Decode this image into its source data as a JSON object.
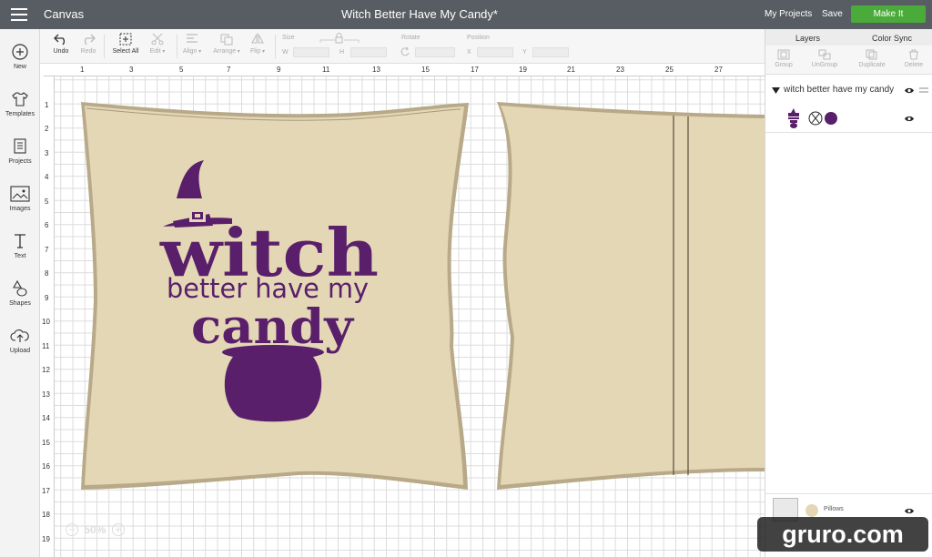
{
  "topbar": {
    "menu_icon": "hamburger-icon",
    "app_name": "Canvas",
    "document_title": "Witch Better Have My Candy*",
    "my_projects": "My Projects",
    "save": "Save",
    "make_it": "Make It",
    "make_it_color": "#4bab3a"
  },
  "sidebar": {
    "items": [
      {
        "label": "New",
        "icon": "plus-circle-icon"
      },
      {
        "label": "Templates",
        "icon": "tshirt-icon"
      },
      {
        "label": "Projects",
        "icon": "projects-icon"
      },
      {
        "label": "Images",
        "icon": "image-icon"
      },
      {
        "label": "Text",
        "icon": "text-icon"
      },
      {
        "label": "Shapes",
        "icon": "shapes-icon"
      },
      {
        "label": "Upload",
        "icon": "upload-cloud-icon"
      }
    ]
  },
  "edit_toolbar": {
    "undo": "Undo",
    "redo": "Redo",
    "select_all": "Select All",
    "edit": "Edit",
    "align": "Align",
    "arrange": "Arrange",
    "flip": "Flip",
    "size": "Size",
    "w": "W",
    "h": "H",
    "rotate": "Rotate",
    "position": "Position",
    "x": "X",
    "y": "Y"
  },
  "rulers": {
    "top": [
      "1",
      "3",
      "5",
      "7",
      "9",
      "11",
      "13",
      "15",
      "17",
      "19",
      "21",
      "23",
      "25",
      "27"
    ],
    "left": [
      "1",
      "2",
      "3",
      "4",
      "5",
      "6",
      "7",
      "8",
      "9",
      "10",
      "11",
      "12",
      "13",
      "14",
      "15",
      "16",
      "17",
      "18",
      "19"
    ]
  },
  "design": {
    "line1": "witch",
    "line2": "better have my",
    "line3": "candy",
    "pillow_color": "#e4d7b5",
    "design_color": "#5a1f6a"
  },
  "zoom": {
    "minus": "−",
    "value": "50%",
    "plus": "+"
  },
  "right_panel": {
    "tab_layers": "Layers",
    "tab_color_sync": "Color Sync",
    "actions": [
      "Group",
      "UnGroup",
      "Duplicate",
      "Delete"
    ],
    "group_name": "witch better have my candy",
    "pillows_label": "Pillows"
  },
  "watermark": "gruro.com"
}
